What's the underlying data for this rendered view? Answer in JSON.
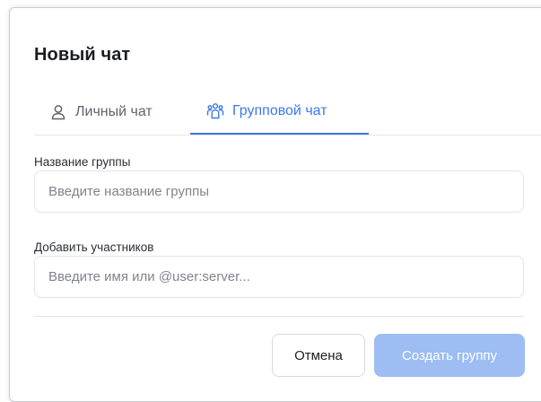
{
  "dialog": {
    "title": "Новый чат"
  },
  "tabs": [
    {
      "label": "Личный чат",
      "icon": "user-icon",
      "active": false
    },
    {
      "label": "Групповой чат",
      "icon": "group-icon",
      "active": true
    }
  ],
  "fields": {
    "group_name": {
      "label": "Название группы",
      "placeholder": "Введите название группы",
      "value": ""
    },
    "members": {
      "label": "Добавить участников",
      "placeholder": "Введите имя или @user:server...",
      "value": ""
    }
  },
  "actions": {
    "cancel_label": "Отмена",
    "create_label": "Создать группу"
  },
  "colors": {
    "accent": "#3b78e7",
    "primary_disabled": "#9dbdf3",
    "text": "#1b1d22",
    "muted": "#5d636c"
  }
}
